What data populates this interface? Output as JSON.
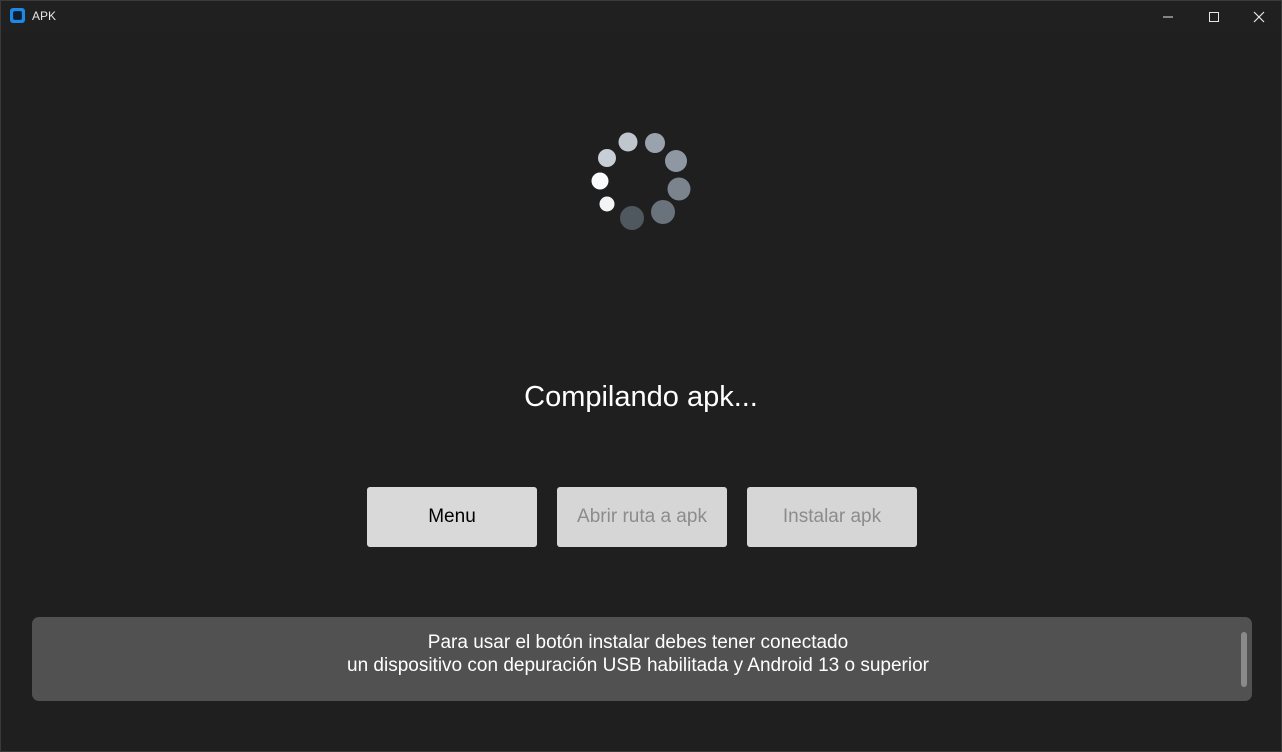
{
  "window": {
    "title": "APK",
    "controls": [
      "minimize-icon",
      "maximize-icon",
      "close-icon"
    ]
  },
  "spinner": {
    "icon": "loading-spinner-icon",
    "dot_colors": [
      "#f2f4f6",
      "#fafbfc",
      "#bfc6ce",
      "#9aa3ad",
      "#8f98a2",
      "#7b838c",
      "#6a737c",
      "#50585f"
    ]
  },
  "main": {
    "status_text": "Compilando apk..."
  },
  "buttons": {
    "menu_label": "Menu",
    "open_path_label": "Abrir ruta a apk",
    "install_label": "Instalar apk"
  },
  "info": {
    "line1": "Para usar el botón instalar debes tener conectado",
    "line2": "un dispositivo con depuración USB habilitada y Android 13 o superior"
  }
}
